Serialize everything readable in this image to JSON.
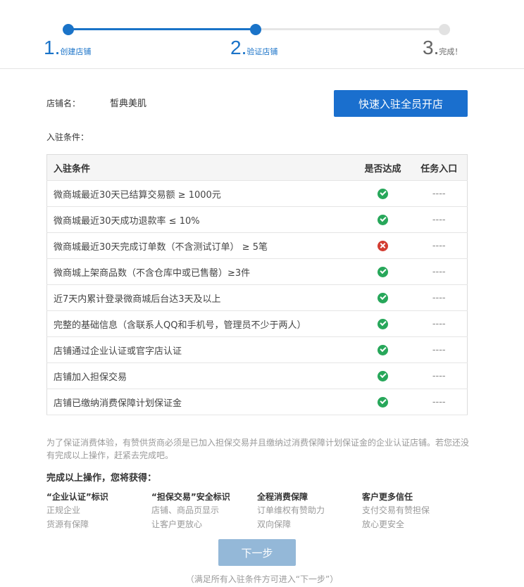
{
  "steps": [
    {
      "num": "1.",
      "label": "创建店铺",
      "state": "done"
    },
    {
      "num": "2.",
      "label": "验证店铺",
      "state": "current"
    },
    {
      "num": "3.",
      "label": "完成！",
      "state": "todo"
    }
  ],
  "shop": {
    "label": "店铺名：",
    "name": "皙典美肌",
    "open_button": "快速入驻全员开店"
  },
  "conditions_caption": "入驻条件：",
  "table": {
    "headers": {
      "name": "入驻条件",
      "ok": "是否达成",
      "task": "任务入口"
    },
    "rows": [
      {
        "name": "微商城最近30天已结算交易额 ≥ 1000元",
        "ok": true,
        "task": "----"
      },
      {
        "name": "微商城最近30天成功退款率 ≤ 10%",
        "ok": true,
        "task": "----"
      },
      {
        "name": "微商城最近30天完成订单数（不含测试订单） ≥ 5笔",
        "ok": false,
        "task": "----"
      },
      {
        "name": "微商城上架商品数（不含仓库中或已售罄）≥3件",
        "ok": true,
        "task": "----"
      },
      {
        "name": "近7天内累计登录微商城后台达3天及以上",
        "ok": true,
        "task": "----"
      },
      {
        "name": "完整的基础信息（含联系人QQ和手机号，管理员不少于两人）",
        "ok": true,
        "task": "----"
      },
      {
        "name": "店铺通过企业认证或官字店认证",
        "ok": true,
        "task": "----"
      },
      {
        "name": "店铺加入担保交易",
        "ok": true,
        "task": "----"
      },
      {
        "name": "店铺已缴纳消费保障计划保证金",
        "ok": true,
        "task": "----"
      }
    ]
  },
  "notice": "为了保证消费体验，有赞供货商必须是已加入担保交易并且缴纳过消费保障计划保证金的企业认证店铺。若您还没有完成以上操作，赶紧去完成吧。",
  "benefit_title": "完成以上操作，您将获得：",
  "benefits": [
    {
      "title": "“企业认证”标识",
      "lines": [
        "正规企业",
        "货源有保障"
      ]
    },
    {
      "title": "“担保交易”安全标识",
      "lines": [
        "店铺、商品页显示",
        "让客户更放心"
      ]
    },
    {
      "title": "全程消费保障",
      "lines": [
        "订单维权有赞助力",
        "双向保障"
      ]
    },
    {
      "title": "客户更多信任",
      "lines": [
        "支付交易有赞担保",
        "放心更安全"
      ]
    }
  ],
  "next_button": "下一步",
  "next_hint": "（满足所有入驻条件方可进入“下一步”）",
  "colors": {
    "primary": "#1a73c8",
    "ok": "#27a75a",
    "fail": "#d33c31",
    "disabled_button": "#94b8d8"
  }
}
